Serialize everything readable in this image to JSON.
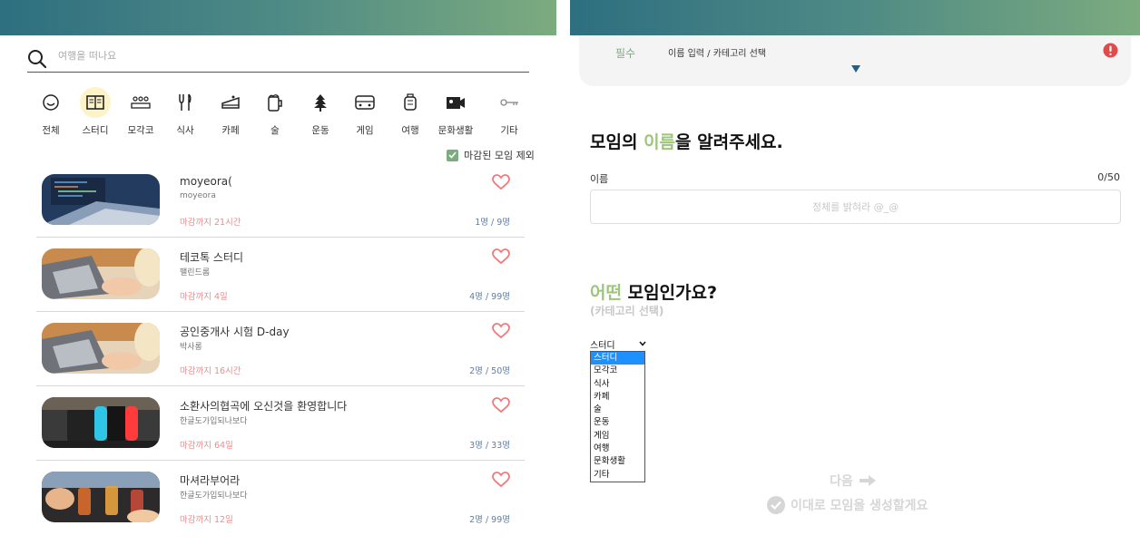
{
  "search": {
    "placeholder": "여행을 떠나요"
  },
  "categories": [
    {
      "label": "전체",
      "icon": "smile-icon"
    },
    {
      "label": "스터디",
      "icon": "book-icon"
    },
    {
      "label": "모각코",
      "icon": "people-icon"
    },
    {
      "label": "식사",
      "icon": "utensils-icon"
    },
    {
      "label": "카페",
      "icon": "cake-icon"
    },
    {
      "label": "술",
      "icon": "beer-icon"
    },
    {
      "label": "운동",
      "icon": "tree-icon"
    },
    {
      "label": "게임",
      "icon": "gamepad-icon"
    },
    {
      "label": "여행",
      "icon": "luggage-icon"
    },
    {
      "label": "문화생활",
      "icon": "camera-icon"
    },
    {
      "label": "기타",
      "icon": "key-icon"
    }
  ],
  "active_category": "스터디",
  "exclude_closed": {
    "label": "마감된 모임 제외",
    "checked": true
  },
  "meetings": [
    {
      "title": "moyeora(",
      "subtitle": "moyeora",
      "deadline": "마감까지 21시간",
      "count": "1명 / 9명",
      "thumb": "laptop-code"
    },
    {
      "title": "테코톡 스터디",
      "subtitle": "팰린드롬",
      "deadline": "마감까지 4일",
      "count": "4명 / 99명",
      "thumb": "laptop-typing"
    },
    {
      "title": "공인중개사 시험 D-day",
      "subtitle": "박사롱",
      "deadline": "마감까지 16시간",
      "count": "2명 / 50명",
      "thumb": "laptop-typing"
    },
    {
      "title": "소환사의협곡에 오신것을 환영합니다",
      "subtitle": "한글도가입되나보다",
      "deadline": "마감까지 64일",
      "count": "3명 / 33명",
      "thumb": "switch"
    },
    {
      "title": "마셔라부어라",
      "subtitle": "한글도가입되나보다",
      "deadline": "마감까지 12일",
      "count": "2명 / 99명",
      "thumb": "drinks"
    }
  ],
  "form": {
    "required_label": "필수",
    "required_text": "이름 입력 / 카테고리 선택",
    "name_heading_pre": "모임의 ",
    "name_heading_hl": "이름",
    "name_heading_post": "을 알려주세요.",
    "name_label": "이름",
    "name_count": "0/50",
    "name_placeholder": "정체를 밝혀라 @_@",
    "cat_heading_hl": "어떤",
    "cat_heading_post": " 모임인가요?",
    "cat_sub": "(카테고리 선택)",
    "select_value": "스터디",
    "options": [
      "스터디",
      "모각코",
      "식사",
      "카페",
      "술",
      "운동",
      "게임",
      "여행",
      "문화생활",
      "기타"
    ],
    "next_label": "다음",
    "create_label": "이대로 모임을 생성할게요"
  },
  "colors": {
    "accent": "#7cab7f",
    "highlight": "#9cc67a",
    "deadline": "#f08b8b",
    "count": "#5c7ea8",
    "alert": "#e04a4a",
    "select": "#1e90ff"
  }
}
